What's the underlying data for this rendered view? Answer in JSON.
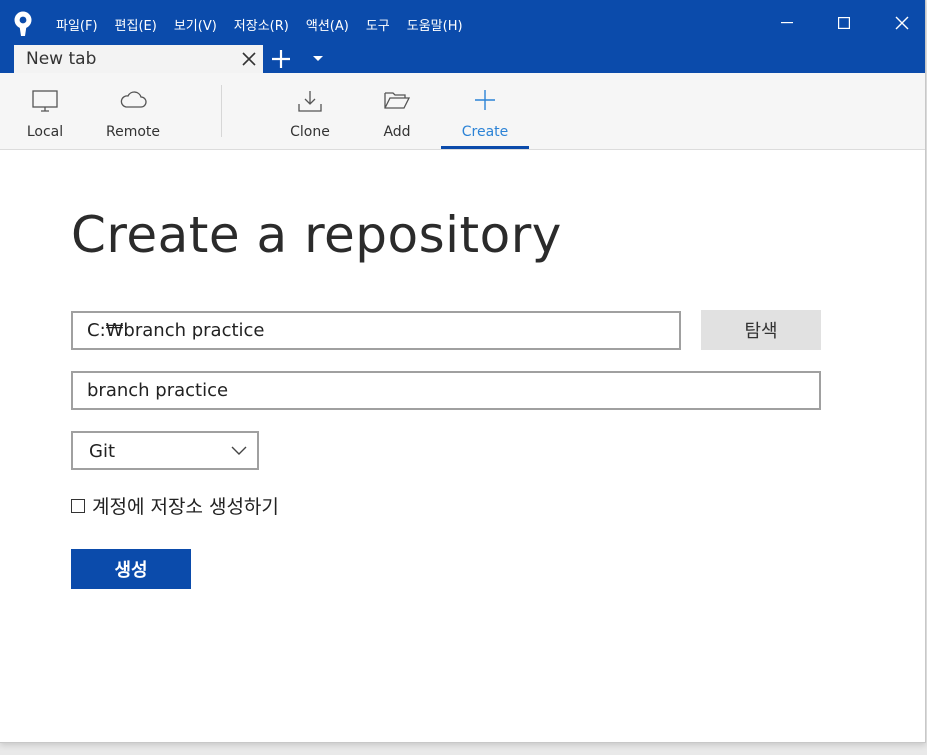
{
  "menu": [
    "파일(F)",
    "편집(E)",
    "보기(V)",
    "저장소(R)",
    "액션(A)",
    "도구",
    "도움말(H)"
  ],
  "tab": {
    "label": "New tab"
  },
  "toolbar": {
    "items": [
      {
        "label": "Local",
        "icon": "monitor-icon"
      },
      {
        "label": "Remote",
        "icon": "cloud-icon"
      },
      {
        "label": "Clone",
        "icon": "download-icon"
      },
      {
        "label": "Add",
        "icon": "folder-open-icon"
      },
      {
        "label": "Create",
        "icon": "plus-icon",
        "active": true
      }
    ]
  },
  "main": {
    "title": "Create a repository",
    "path_value": "C:₩branch practice",
    "browse_label": "탐색",
    "name_value": "branch practice",
    "vcs_selected": "Git",
    "checkbox_label": "계정에 저장소 생성하기",
    "checkbox_checked": false,
    "create_label": "생성"
  },
  "colors": {
    "brand": "#0b4bab",
    "active_tab_text": "#2c83d6"
  }
}
